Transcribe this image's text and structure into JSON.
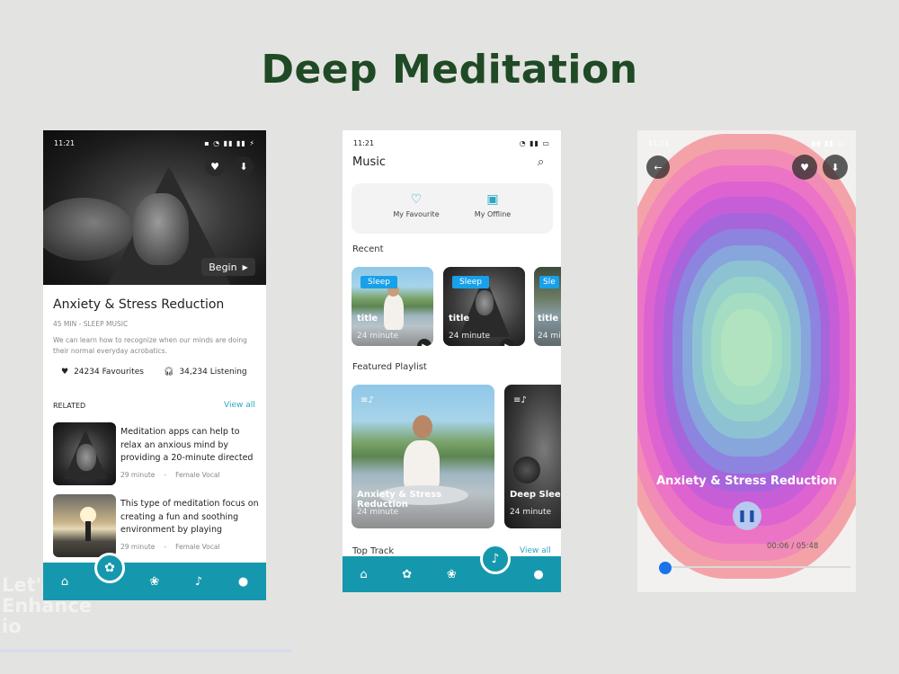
{
  "page": {
    "title": "Deep Meditation"
  },
  "watermark": {
    "lines": [
      "Let's",
      "Enhance",
      "io"
    ]
  },
  "phone1": {
    "status": {
      "time": "11:21",
      "icons": "▪ ◔ ▮▮ ▮▮ ⚡"
    },
    "hero_actions": {
      "favorite_icon": "heart-icon",
      "download_icon": "download-icon"
    },
    "begin_label": "Begin",
    "title": "Anxiety & Stress Reduction",
    "subtitle": "45 MIN - SLEEP MUSIC",
    "description": "We can learn how to recognize when our minds are doing their normal everyday acrobatics.",
    "favourites": "24234 Favourites",
    "listening": "34,234 Listening",
    "related_label": "RELATED",
    "view_all": "View all",
    "related": [
      {
        "text": "Meditation apps can help to relax an anxious mind by providing a 20-minute directed",
        "duration": "29 minute",
        "sep": "-",
        "voice": "Female Vocal"
      },
      {
        "text": "This type of meditation focus on creating a fun and soothing environment by playing",
        "duration": "29 minute",
        "sep": "-",
        "voice": "Female Vocal"
      }
    ],
    "tabs": [
      "home-icon",
      "meditate-icon",
      "lotus-icon",
      "music-icon",
      "profile-icon"
    ]
  },
  "phone2": {
    "status": {
      "time": "11:21",
      "icons": "◔ ▮▮ ▭"
    },
    "title": "Music",
    "my_favourite": "My Favourite",
    "my_offline": "My Offline",
    "recent_label": "Recent",
    "recent": [
      {
        "badge": "Sleep",
        "title": "title",
        "duration": "24 minute"
      },
      {
        "badge": "Sleep",
        "title": "title",
        "duration": "24 minute"
      },
      {
        "badge": "Sle",
        "title": "title",
        "duration": "24 mi"
      }
    ],
    "featured_label": "Featured Playlist",
    "featured": [
      {
        "title": "Anxiety & Stress Reduction",
        "duration": "24 minute"
      },
      {
        "title": "Deep Sleep",
        "duration": "24 minute"
      }
    ],
    "top_track_label": "Top Track",
    "view_all": "View all"
  },
  "phone3": {
    "status": {
      "time": "11:21",
      "icons": "▮▮ ▮▮ ▭"
    },
    "song_title": "Anxiety & Stress Reduction",
    "time_display": "00:06 / 05:48",
    "progress": 0.02,
    "ring_colors": [
      "#f3a3a8",
      "#f28bb6",
      "#ec74c6",
      "#dc63d0",
      "#c65ed8",
      "#a765dc",
      "#8d84df",
      "#86a6dc",
      "#8dc2d3",
      "#98d3c9",
      "#a4ddc2",
      "#b1e3c0"
    ]
  }
}
